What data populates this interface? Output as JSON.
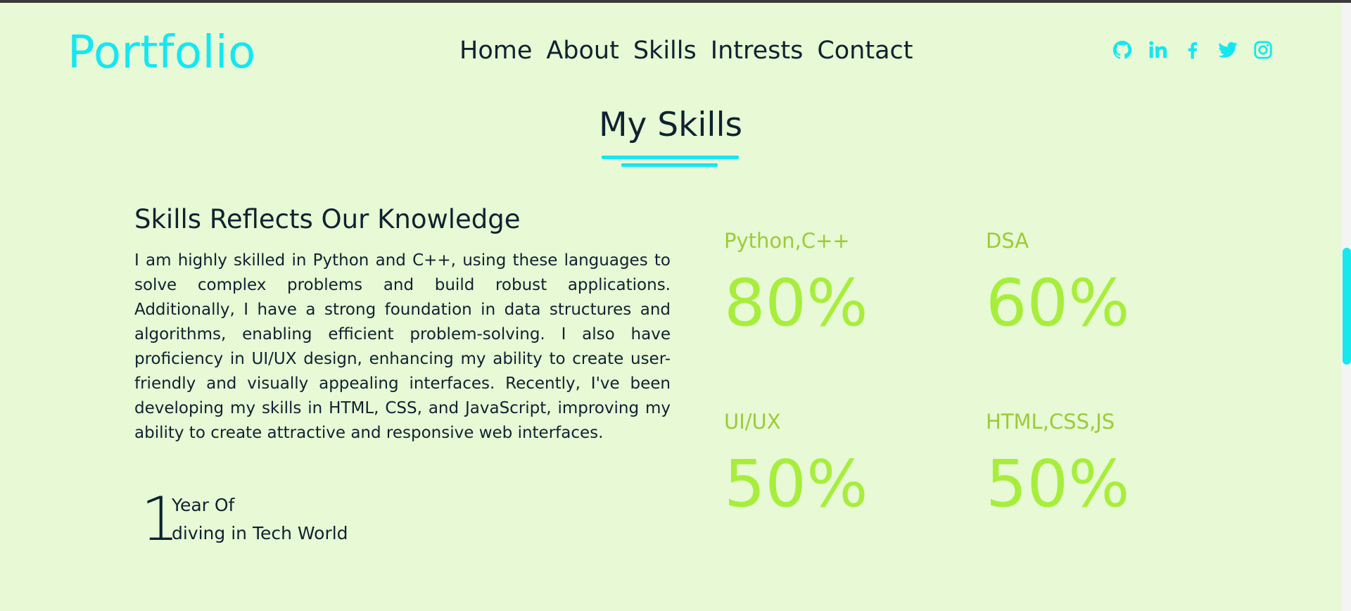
{
  "colors": {
    "background": "#e7f9d5",
    "accent": "#15e7f1",
    "text": "#0f2230",
    "skill_label": "#9ccc35",
    "skill_value": "#a7ee3c"
  },
  "header": {
    "logo": "Portfolio",
    "nav": [
      "Home",
      "About",
      "Skills",
      "Intrests",
      "Contact"
    ],
    "social_icons": [
      "github-icon",
      "linkedin-icon",
      "facebook-icon",
      "twitter-icon",
      "instagram-icon"
    ]
  },
  "skills_section": {
    "title": "My Skills",
    "heading": "Skills Reflects Our Knowledge",
    "description": "I am highly skilled in Python and C++, using these languages to solve complex problems and build robust applications. Additionally, I have a strong foundation in data structures and algorithms, enabling efficient problem-solving. I also have proficiency in UI/UX design, enhancing my ability to create user-friendly and visually appealing interfaces. Recently, I've been developing my skills in HTML, CSS, and JavaScript, improving my ability to create attractive and responsive web interfaces.",
    "experience": {
      "number": "1",
      "line1": "Year Of",
      "line2": "diving in Tech World"
    },
    "items": [
      {
        "label": "Python,C++",
        "value": "80%"
      },
      {
        "label": "DSA",
        "value": "60%"
      },
      {
        "label": "UI/UX",
        "value": "50%"
      },
      {
        "label": "HTML,CSS,JS",
        "value": "50%"
      }
    ]
  }
}
